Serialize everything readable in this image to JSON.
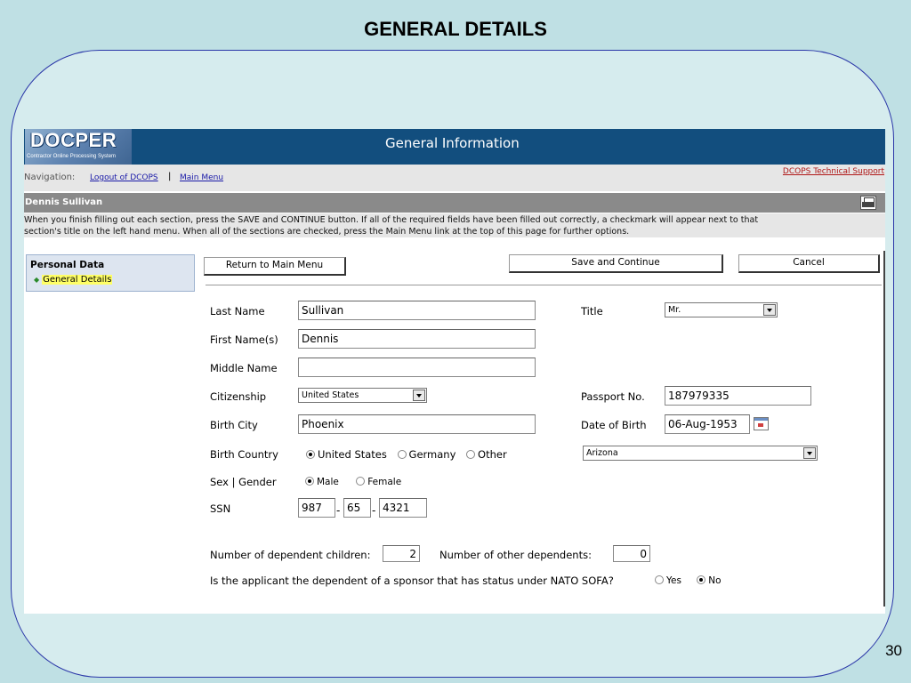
{
  "slide": {
    "title": "GENERAL DETAILS",
    "number": "30"
  },
  "app": {
    "logo_main": "DOCPER",
    "logo_sub": "Contractor Online Processing System",
    "banner_title": "General Information"
  },
  "nav": {
    "label": "Navigation:",
    "logout": "Logout of DCOPS",
    "separator": "|",
    "main_menu": "Main Menu",
    "tech_support": "DCOPS Technical Support"
  },
  "user": {
    "name": "Dennis Sullivan"
  },
  "instructions": {
    "line1": "When you finish filling out each section, press the SAVE and CONTINUE button. If all of the required fields have been filled out correctly, a checkmark will appear next to that",
    "line2": "section's title on the left hand menu. When all of the sections are checked, press the Main Menu link at the top of this page for further options."
  },
  "sidebar": {
    "section": "Personal Data",
    "item": "General Details"
  },
  "buttons": {
    "return_main": "Return to Main Menu",
    "save_continue": "Save and Continue",
    "cancel": "Cancel"
  },
  "form": {
    "last_name": {
      "label": "Last Name",
      "value": "Sullivan"
    },
    "first_name": {
      "label": "First Name(s)",
      "value": "Dennis"
    },
    "middle_name": {
      "label": "Middle Name",
      "value": ""
    },
    "citizenship": {
      "label": "Citizenship",
      "value": "United States"
    },
    "birth_city": {
      "label": "Birth City",
      "value": "Phoenix"
    },
    "birth_country": {
      "label": "Birth Country",
      "options": [
        "United States",
        "Germany",
        "Other"
      ],
      "selected": "United States",
      "state": "Arizona"
    },
    "sex": {
      "label": "Sex | Gender",
      "options": [
        "Male",
        "Female"
      ],
      "selected": "Male"
    },
    "ssn": {
      "label": "SSN",
      "part1": "987",
      "part2": "65",
      "part3": "4321",
      "dash": "-"
    },
    "title": {
      "label": "Title",
      "value": "Mr."
    },
    "passport": {
      "label": "Passport No.",
      "value": "187979335"
    },
    "dob": {
      "label": "Date of Birth",
      "value": "06-Aug-1953"
    },
    "dependent_children": {
      "label": "Number of dependent children:",
      "value": "2"
    },
    "other_dependents": {
      "label": "Number of other dependents:",
      "value": "0"
    },
    "nato_sofa": {
      "label": "Is the applicant the dependent of a sponsor that has status under NATO SOFA?",
      "options": [
        "Yes",
        "No"
      ],
      "selected": "No"
    }
  },
  "colors": {
    "banner": "#124e7e",
    "slide_bg": "#bfe0e4",
    "frame_border": "#2a36a8",
    "support_link": "#b01818"
  }
}
